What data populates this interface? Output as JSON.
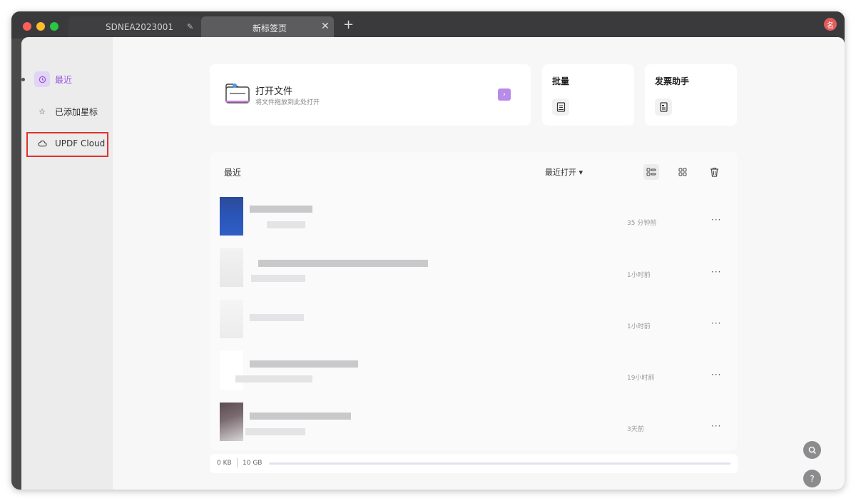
{
  "tabs": [
    {
      "label": "SDNEA2023001",
      "active": false
    },
    {
      "label": "新标签页",
      "active": true
    }
  ],
  "titlebar": {
    "avatar_text": "名",
    "new_tab_icon": "plus-icon"
  },
  "sidebar": {
    "items": [
      {
        "label": "最近",
        "icon": "clock-icon",
        "active": true
      },
      {
        "label": "已添加星标",
        "icon": "star-icon",
        "active": false
      },
      {
        "label": "UPDF Cloud",
        "icon": "cloud-icon",
        "active": false
      }
    ]
  },
  "open_file": {
    "title": "打开文件",
    "subtitle": "将文件拖放到此处打开"
  },
  "quick_cards": [
    {
      "title": "批量",
      "icon": "batch-icon"
    },
    {
      "title": "发票助手",
      "icon": "invoice-icon"
    }
  ],
  "recent_list": {
    "header": "最近",
    "sort_label": "最近打开 ▾",
    "rows": [
      {
        "time": "35 分钟前"
      },
      {
        "time": "1小时前"
      },
      {
        "time": "1小时前"
      },
      {
        "time": "19小时前"
      },
      {
        "time": "3天前"
      }
    ],
    "more_label": "···"
  },
  "storage": {
    "used": "0 KB",
    "total": "10 GB",
    "used_fraction": 0.0
  },
  "colors": {
    "accent": "#9a5bde",
    "highlight_box": "#e0332e"
  }
}
